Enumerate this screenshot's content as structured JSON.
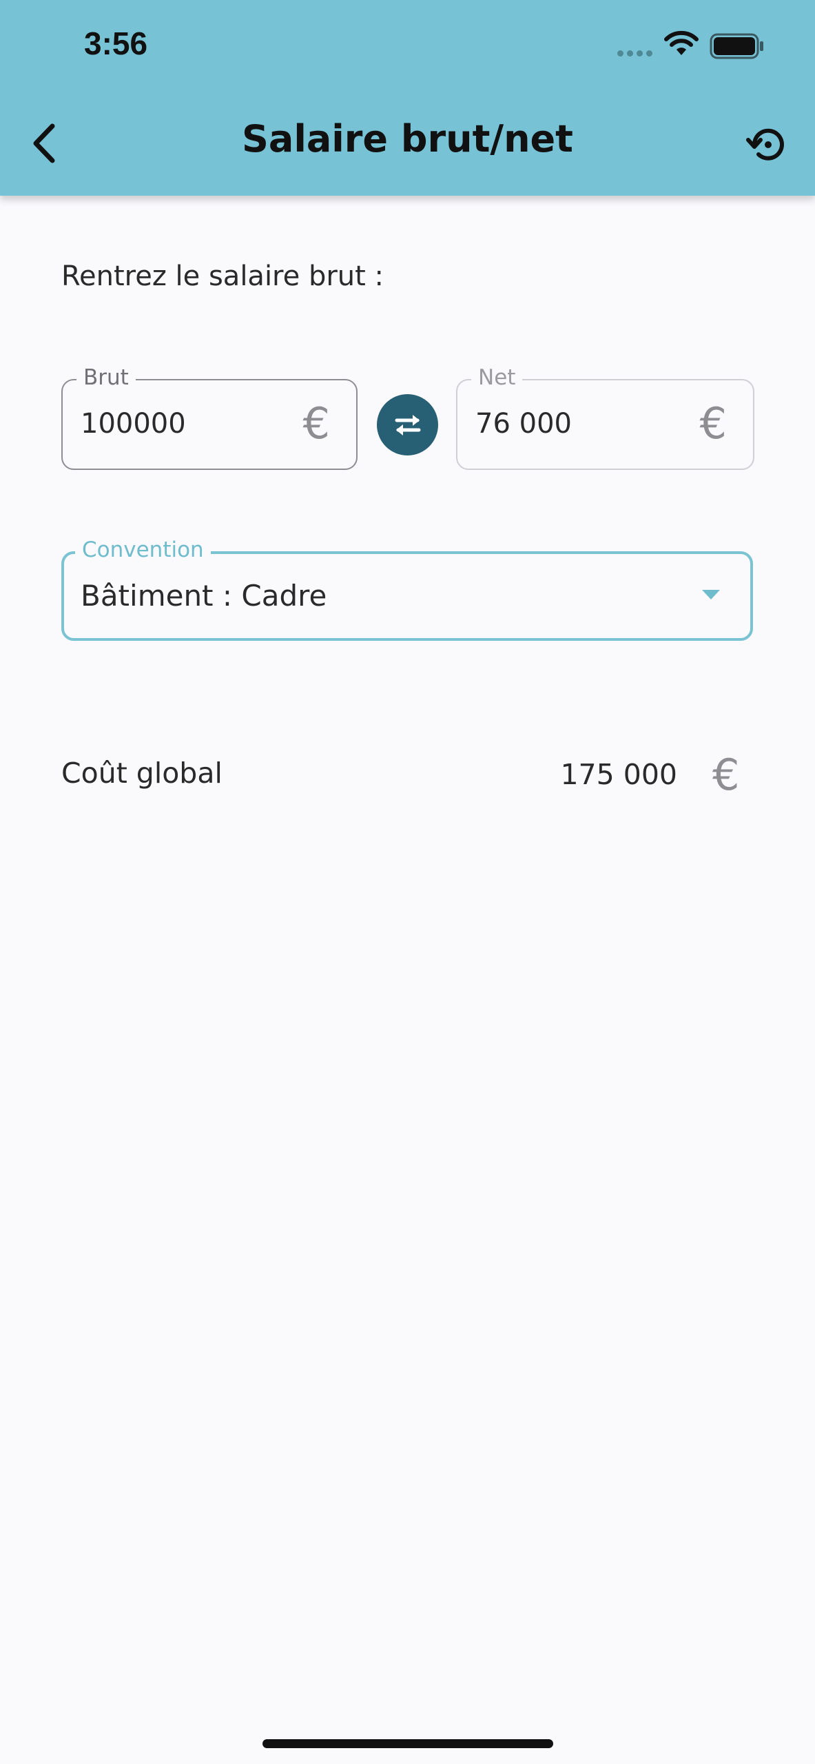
{
  "status_bar": {
    "time": "3:56"
  },
  "header": {
    "title": "Salaire brut/net"
  },
  "form": {
    "prompt": "Rentrez le salaire brut :",
    "brut": {
      "label": "Brut",
      "value": "100000",
      "currency": "€"
    },
    "net": {
      "label": "Net",
      "value": "76 000",
      "currency": "€"
    },
    "convention": {
      "label": "Convention",
      "selected": "Bâtiment : Cadre"
    }
  },
  "result": {
    "label": "Coût global",
    "value": "175 000",
    "currency": "€"
  },
  "colors": {
    "header_bg": "#77c2d5",
    "accent": "#7ac3d3",
    "swap_button": "#275f74",
    "background": "#faf9fc"
  }
}
